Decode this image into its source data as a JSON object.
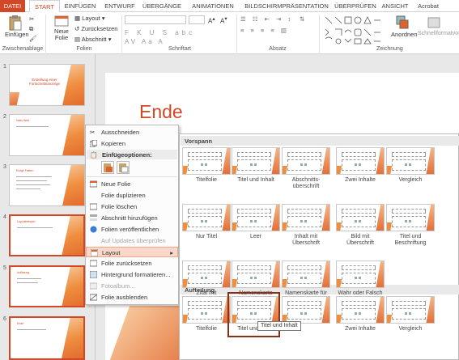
{
  "ribbon": {
    "tabs": [
      "DATEI",
      "START",
      "EINFÜGEN",
      "ENTWURF",
      "ÜBERGÄNGE",
      "ANIMATIONEN",
      "BILDSCHIRMPRÄSENTATION",
      "ÜBERPRÜFEN",
      "ANSICHT",
      "Acrobat"
    ],
    "clipboard": {
      "paste": "Einfügen",
      "group": "Zwischenablage"
    },
    "slides": {
      "new_slide": "Neue Folie",
      "layout": "Layout",
      "reset": "Zurücksetzen",
      "section": "Abschnitt",
      "group": "Folien"
    },
    "font_group": "Schriftart",
    "paragraph_group": "Absatz",
    "drawing": {
      "arrange": "Anordnen",
      "quick_styles": "Schnellformatvorlagen",
      "group": "Zeichnung"
    },
    "accent": "#d24726"
  },
  "thumbnails": [
    {
      "num": "1",
      "title": "Erstellung einer Fortschrittsanzeige"
    },
    {
      "num": "2",
      "title": "Hallo Welt"
    },
    {
      "num": "3",
      "title": "Einige Fakten"
    },
    {
      "num": "4",
      "title": "Layoutbeispiel"
    },
    {
      "num": "5",
      "title": "Auflistung"
    },
    {
      "num": "6",
      "title": "Ende"
    }
  ],
  "main_slide": {
    "title": "Ende",
    "right_text": "en"
  },
  "context_menu": {
    "cut": "Ausschneiden",
    "copy": "Kopieren",
    "paste_options": "Einfügeoptionen:",
    "new_slide": "Neue Folie",
    "duplicate": "Folie duplizieren",
    "delete": "Folie löschen",
    "add_section": "Abschnitt hinzufügen",
    "publish": "Folien veröffentlichen",
    "check_updates": "Auf Updates überprüfen",
    "layout": "Layout",
    "reset": "Folie zurücksetzen",
    "background": "Hintergrund formatieren...",
    "photo_album": "Fotoalbum...",
    "hide": "Folie ausblenden"
  },
  "layout_gallery": {
    "section1": "Vorspann",
    "section2": "Aufteilung",
    "row1": [
      "Titelfolie",
      "Titel und Inhalt",
      "Abschnitts-\nüberschrift",
      "Zwei Inhalte",
      "Vergleich"
    ],
    "row2": [
      "Nur Titel",
      "Leer",
      "Inhalt mit\nÜberschrift",
      "Bild mit\nÜberschrift",
      "Titel und\nBeschriftung"
    ],
    "row3": [
      "Zitat mit\nBeschriftung",
      "Namenskarte",
      "Namenskarte für\nZitat",
      "Wahr oder Falsch"
    ],
    "row4": [
      "Titelfolie",
      "Titel und Inhalt",
      "",
      "Zwei Inhalte",
      "Vergleich"
    ],
    "tooltip": "Titel und Inhalt"
  }
}
